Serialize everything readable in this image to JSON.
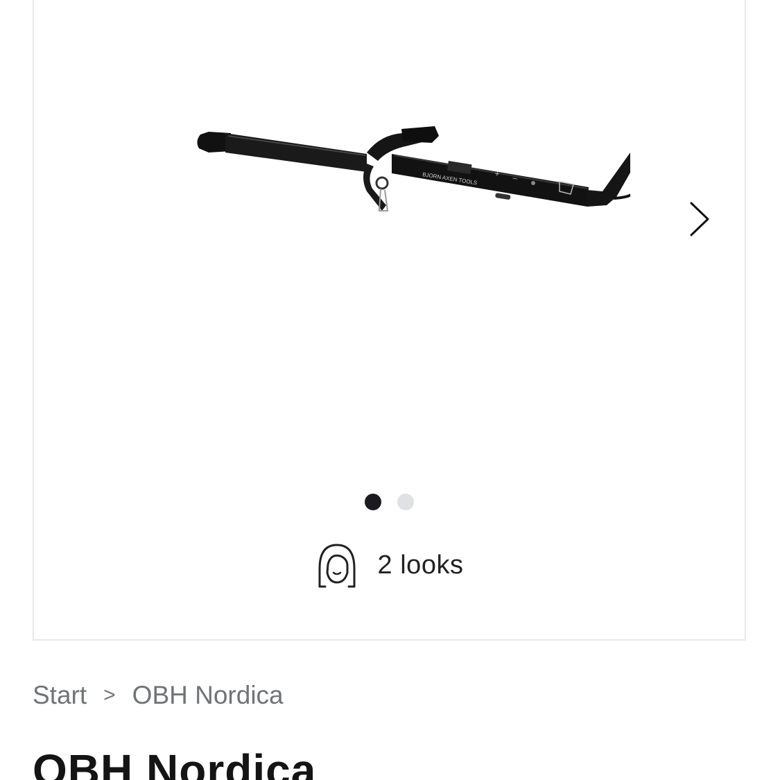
{
  "gallery": {
    "product_image_alt": "Björn Axén Tools curling iron",
    "product_brand_text": "BJORN AXEN TOOLS",
    "next_label": "Next image",
    "dots": [
      {
        "active": true
      },
      {
        "active": false
      }
    ],
    "looks": {
      "label": "2 looks",
      "icon": "face-portrait-icon"
    },
    "colors": {
      "border": "#e6e8ea",
      "dot_active": "#1b1b1f",
      "dot_inactive": "#dfe1e5"
    }
  },
  "breadcrumb": {
    "items": [
      {
        "label": "Start"
      },
      {
        "label": "OBH Nordica"
      }
    ],
    "separator": ">"
  },
  "product": {
    "title": "OBH Nordica"
  }
}
